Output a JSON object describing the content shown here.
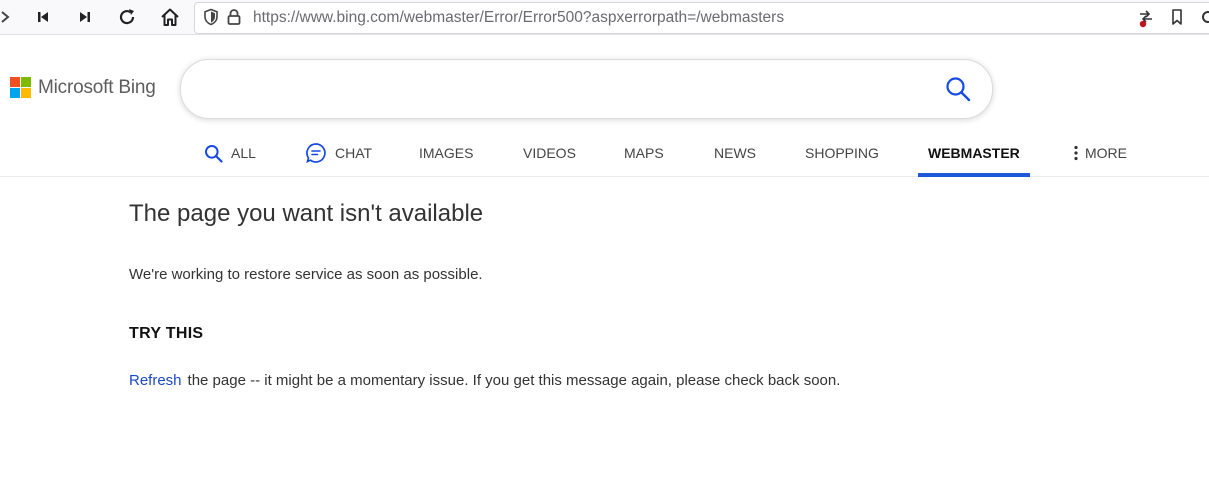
{
  "browser": {
    "url": "https://www.bing.com/webmaster/Error/Error500?aspxerrorpath=/webmasters"
  },
  "header": {
    "logo_text": "Microsoft Bing",
    "search": {
      "value": "",
      "placeholder": ""
    }
  },
  "tabs": [
    {
      "label": "ALL",
      "icon": "search-icon"
    },
    {
      "label": "CHAT",
      "icon": "chat-icon"
    },
    {
      "label": "IMAGES"
    },
    {
      "label": "VIDEOS"
    },
    {
      "label": "MAPS"
    },
    {
      "label": "NEWS"
    },
    {
      "label": "SHOPPING"
    },
    {
      "label": "WEBMASTER",
      "active": true
    },
    {
      "label": "MORE",
      "icon": "more-vertical-icon"
    }
  ],
  "error": {
    "title": "The page you want isn't available",
    "message": "We're working to restore service as soon as possible.",
    "try_title": "TRY THIS",
    "refresh_link": "Refresh",
    "try_text": "the page -- it might be a momentary issue. If you get this message again, please check back soon."
  },
  "colors": {
    "accent": "#1f59d8",
    "link": "#1a49c5",
    "ms_red": "#f25022",
    "ms_green": "#7fba00",
    "ms_blue": "#00a4ef",
    "ms_yellow": "#ffb900"
  }
}
